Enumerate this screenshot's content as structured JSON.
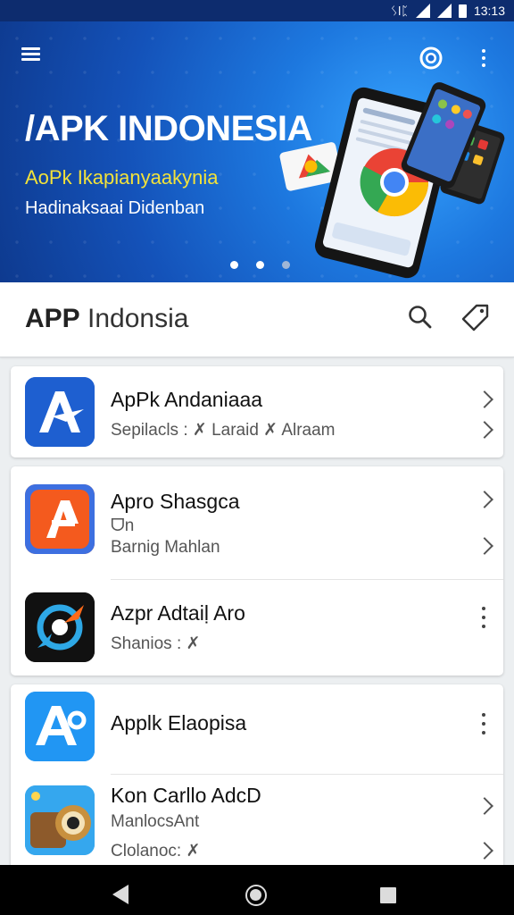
{
  "status_bar": {
    "time": "13:13",
    "signal_label": "ᛊǀᛈ"
  },
  "hero": {
    "title": "/APK INDONESIA",
    "subtitle": "AoPk Ikapianyaakynia",
    "caption": "Hadinaksaai Didenban",
    "pager_count": 3,
    "pager_active": 2
  },
  "app_bar": {
    "title_bold": "APP",
    "title_rest": "Indonsia"
  },
  "apps": [
    {
      "name": "ApPk Andaniaaa",
      "meta1": "Sepilacls : ✗ Laraid ✗ Alraam",
      "action": "chevron"
    },
    {
      "name": "Apro Shasgca",
      "meta1": "ᗜn",
      "meta2": "Barnig Mahlan",
      "action": "chevron"
    },
    {
      "name": "Azpr Adtaiḷ Aro",
      "meta1": "Shanios : ✗",
      "action": "kebab"
    },
    {
      "name": "Applk Elaopisa",
      "action": "kebab"
    },
    {
      "name": "Kon Carllo AdcD",
      "meta1": "ManlocsAnt",
      "meta2": "Clolanoc: ✗",
      "action": "chevron"
    }
  ],
  "colors": {
    "hero_bg": "#1452b9",
    "accent_yellow": "#f2e23a",
    "status_bg": "#0d2c6e"
  }
}
